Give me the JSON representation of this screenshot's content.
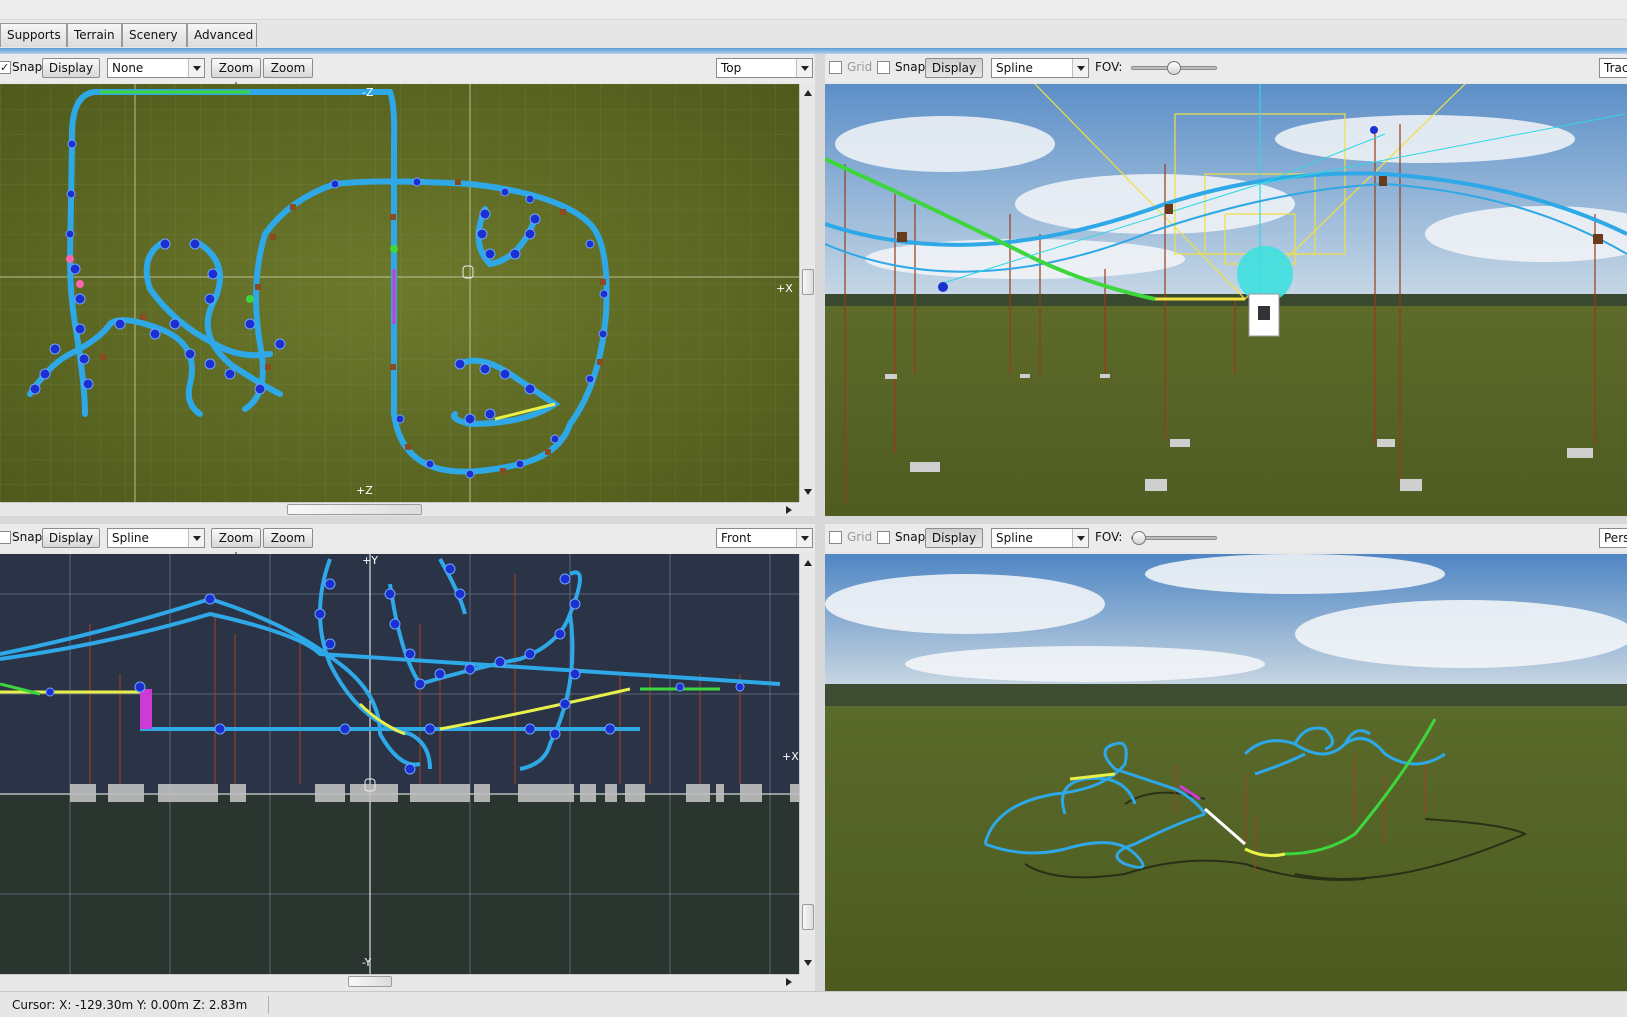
{
  "tabs": [
    {
      "label": "Supports"
    },
    {
      "label": "Terrain"
    },
    {
      "label": "Scenery"
    },
    {
      "label": "Advanced"
    }
  ],
  "top_left": {
    "snap_label": "Snap",
    "display_label": "Display",
    "mode_value": "None",
    "zoom_in_label": "Zoom +",
    "zoom_out_label": "Zoom -",
    "view_value": "Top",
    "axis_z": "-Z",
    "axis_plus_z": "+Z",
    "axis_plus_x": "+X"
  },
  "top_right": {
    "grid_label": "Grid",
    "snap_label": "Snap",
    "display_label": "Display",
    "mode_value": "Spline",
    "fov_label": "FOV:",
    "fov_level": 0.5,
    "view_value": "Track"
  },
  "bottom_left": {
    "snap_label": "Snap",
    "display_label": "Display",
    "mode_value": "Spline",
    "zoom_in_label": "Zoom +",
    "zoom_out_label": "Zoom -",
    "view_value": "Front",
    "axis_y": "+Y",
    "axis_minus_y": "-Y",
    "axis_plus_x": "+X"
  },
  "bottom_right": {
    "grid_label": "Grid",
    "snap_label": "Snap",
    "display_label": "Display",
    "mode_value": "Spline",
    "fov_label": "FOV:",
    "fov_level": 0.0,
    "view_value": "Perspective"
  },
  "status": {
    "cursor_text": "Cursor: X: -129.30m Y: 0.00m Z: 2.83m"
  },
  "colors": {
    "accent": "#4a90d9",
    "track_rail": "#2ea8e6",
    "node": "#1c2fd0",
    "lift": "#3dd63d",
    "support": "#a0421c",
    "grass": "#5e6a22",
    "front_bg": "#2b3446",
    "sky": "#6f9fcf"
  },
  "icons": [
    "checkbox-icon",
    "dropdown-arrow-icon",
    "scroll-up-icon",
    "scroll-down-icon",
    "scroll-right-icon",
    "slider-thumb-icon"
  ]
}
